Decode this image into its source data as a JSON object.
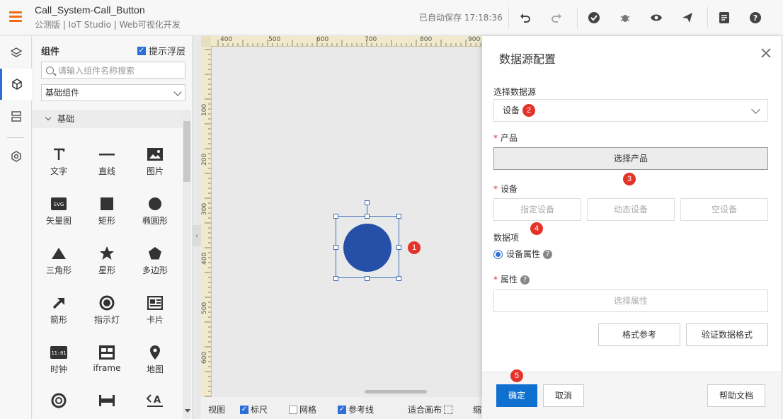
{
  "header": {
    "title": "Call_System-Call_Button",
    "subtitle": "公测版 | IoT Studio | Web可视化开发",
    "autosave": "已自动保存 17:18:36"
  },
  "panel": {
    "title": "组件",
    "float_label": "提示浮层",
    "search_placeholder": "请输入组件名称搜索",
    "category": "基础组件",
    "group": "基础",
    "components": [
      {
        "label": "文字",
        "icon": "text-icon"
      },
      {
        "label": "直线",
        "icon": "line-icon"
      },
      {
        "label": "图片",
        "icon": "image-icon"
      },
      {
        "label": "矢量图",
        "icon": "svg-icon"
      },
      {
        "label": "矩形",
        "icon": "rectangle-icon"
      },
      {
        "label": "椭圆形",
        "icon": "ellipse-icon"
      },
      {
        "label": "三角形",
        "icon": "triangle-icon"
      },
      {
        "label": "星形",
        "icon": "star-icon"
      },
      {
        "label": "多边形",
        "icon": "polygon-icon"
      },
      {
        "label": "箭形",
        "icon": "arrow-icon"
      },
      {
        "label": "指示灯",
        "icon": "indicator-icon"
      },
      {
        "label": "卡片",
        "icon": "card-icon"
      },
      {
        "label": "时钟",
        "icon": "clock-icon"
      },
      {
        "label": "iframe",
        "icon": "iframe-icon"
      },
      {
        "label": "地图",
        "icon": "map-pin-icon"
      }
    ],
    "svg_glyph": "SVG",
    "clock_glyph": "11:01"
  },
  "ruler": {
    "top": [
      "400",
      "500",
      "600",
      "700",
      "800",
      "900"
    ],
    "left": [
      "100",
      "200",
      "300",
      "400",
      "500",
      "600"
    ]
  },
  "canvas_bar": {
    "view": "视图",
    "ruler": "标尺",
    "grid": "网格",
    "guide": "参考线",
    "fit": "适合画布",
    "zoom": "缩"
  },
  "drawer": {
    "title": "数据源配置",
    "source_label": "选择数据源",
    "source_value": "设备",
    "product_label": "产品",
    "product_button": "选择产品",
    "device_label": "设备",
    "device_buttons": [
      "指定设备",
      "动态设备",
      "空设备"
    ],
    "data_item_label": "数据项",
    "data_item_option": "设备属性",
    "attr_label": "属性",
    "attr_button": "选择属性",
    "format_ref": "格式参考",
    "verify_format": "验证数据格式",
    "ok": "确定",
    "cancel": "取消",
    "help_doc": "帮助文档"
  },
  "badges": [
    "1",
    "2",
    "3",
    "4",
    "5"
  ],
  "colors": {
    "accent": "#1070d0",
    "circle": "#2650a8",
    "badge": "#e5332a",
    "menu": "#f06a1b"
  }
}
